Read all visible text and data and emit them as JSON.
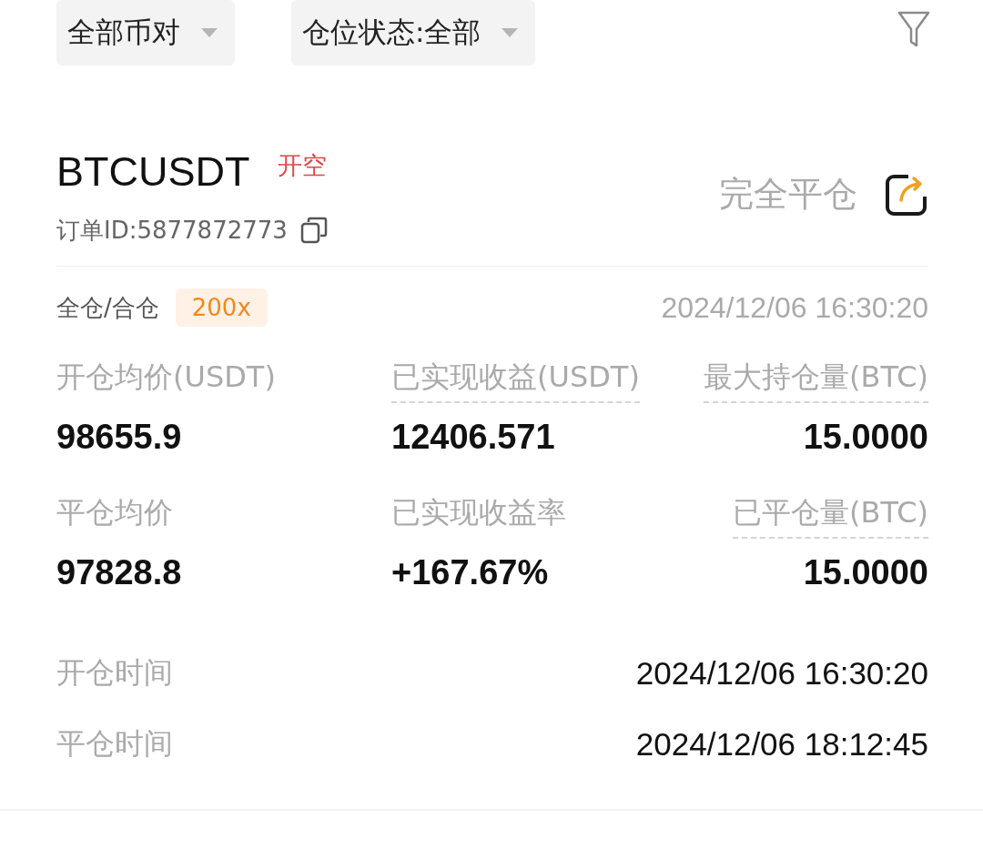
{
  "filters": [
    {
      "label": "全部币对"
    },
    {
      "label": "仓位状态:全部"
    }
  ],
  "position": {
    "symbol": "BTCUSDT",
    "side": "开空",
    "order_id": "订单ID:5877872773",
    "close_button": "完全平仓",
    "margin_mode": "全仓/合仓",
    "leverage": "200x",
    "time": "2024/12/06 16:30:20",
    "stats": [
      {
        "label": "开仓均价(USDT)",
        "value": "98655.9",
        "underlined": false
      },
      {
        "label": "已实现收益(USDT)",
        "value": "12406.571",
        "underlined": true
      },
      {
        "label": "最大持仓量(BTC)",
        "value": "15.0000",
        "underlined": true
      },
      {
        "label": "平仓均价",
        "value": "97828.8",
        "underlined": false
      },
      {
        "label": "已实现收益率",
        "value": "+167.67%",
        "underlined": false
      },
      {
        "label": "已平仓量(BTC)",
        "value": "15.0000",
        "underlined": true
      }
    ],
    "times": [
      {
        "label": "开仓时间",
        "value": "2024/12/06 16:30:20"
      },
      {
        "label": "平仓时间",
        "value": "2024/12/06 18:12:45"
      }
    ]
  }
}
